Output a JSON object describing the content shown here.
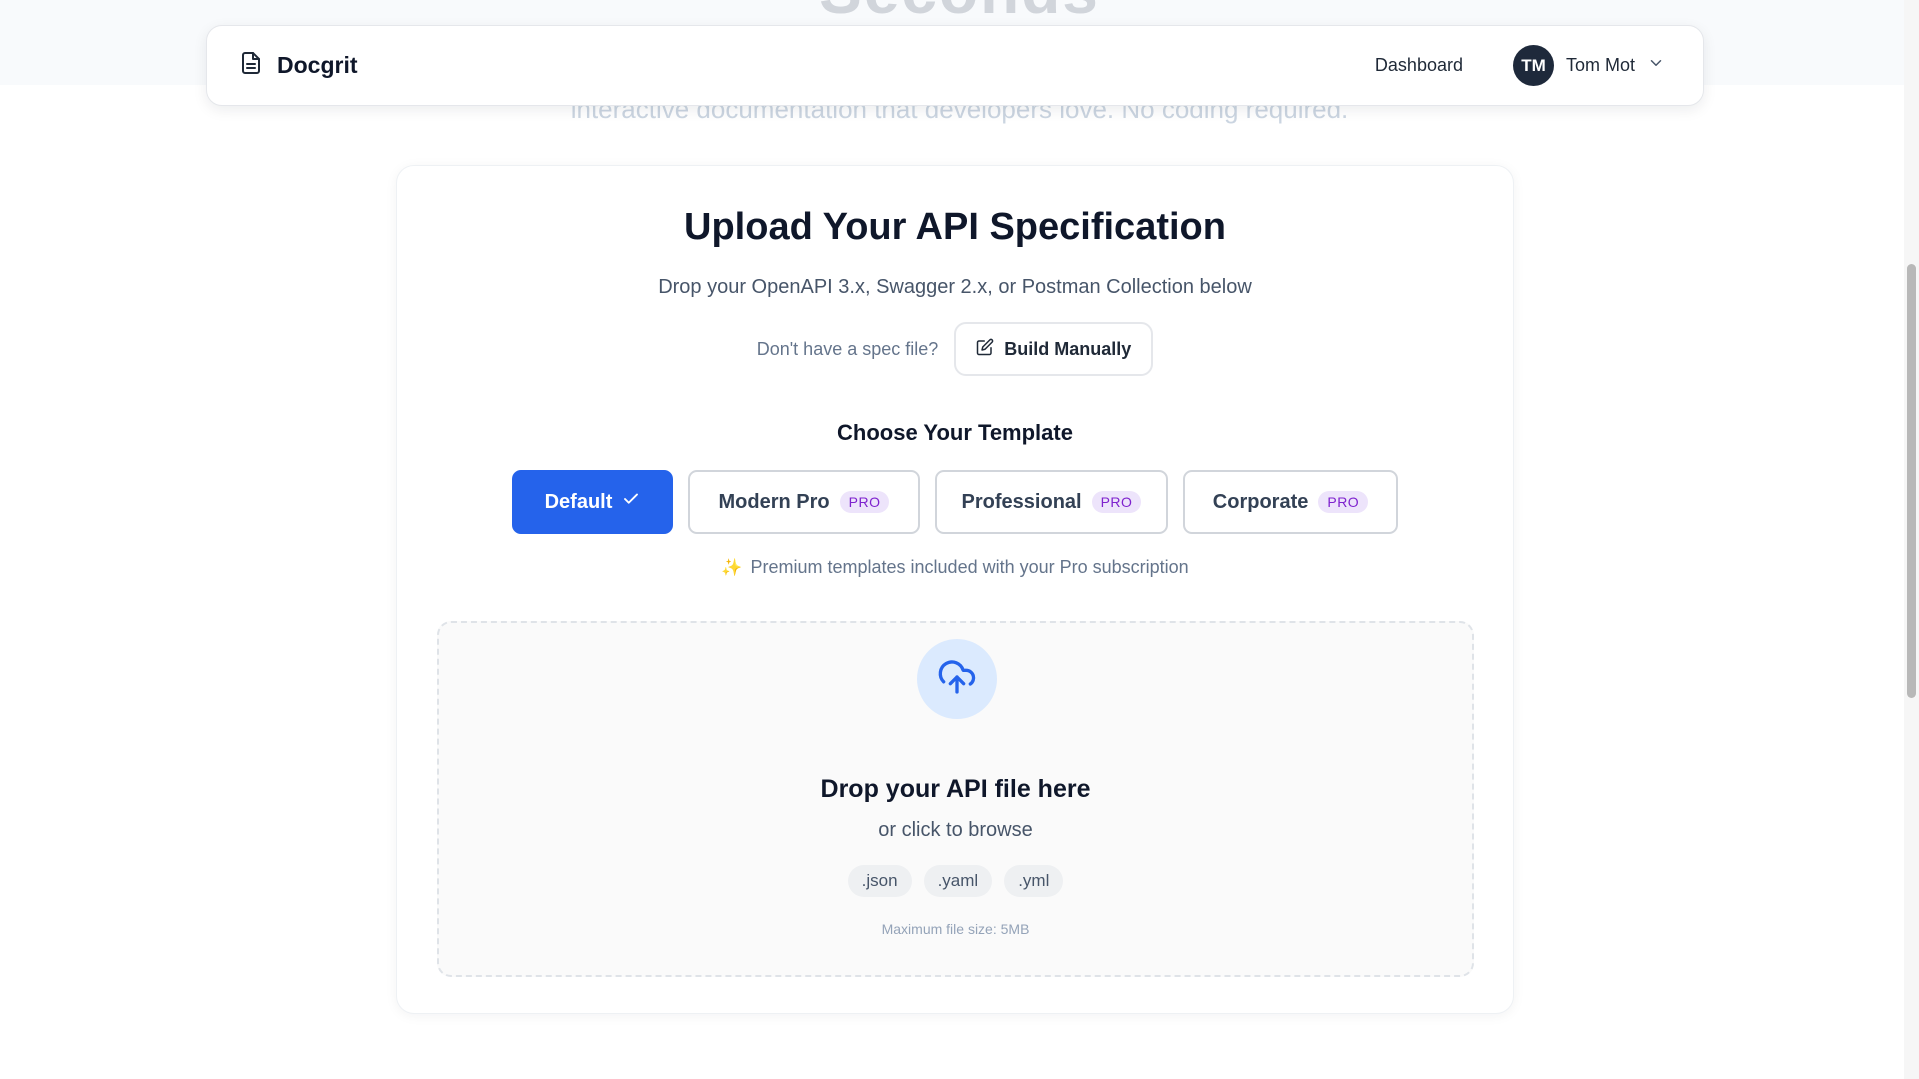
{
  "hero": {
    "ghost_title": "Seconds",
    "ghost_subtitle": "interactive documentation that developers love. No coding required."
  },
  "nav": {
    "brand": "Docgrit",
    "dashboard_label": "Dashboard",
    "user_initials": "TM",
    "user_name": "Tom Mot"
  },
  "upload_card": {
    "title": "Upload Your API Specification",
    "subtitle": "Drop your OpenAPI 3.x, Swagger 2.x, or Postman Collection below",
    "manual_hint": "Don't have a spec file?",
    "build_manually_label": "Build Manually",
    "template_heading": "Choose Your Template",
    "templates": [
      {
        "label": "Default",
        "selected": true,
        "pro": false
      },
      {
        "label": "Modern Pro",
        "selected": false,
        "pro": true,
        "badge": "PRO"
      },
      {
        "label": "Professional",
        "selected": false,
        "pro": true,
        "badge": "PRO"
      },
      {
        "label": "Corporate",
        "selected": false,
        "pro": true,
        "badge": "PRO"
      }
    ],
    "premium_note": "Premium templates included with your Pro subscription",
    "dropzone": {
      "title": "Drop your API file here",
      "subtitle": "or click to browse",
      "extensions": [
        ".json",
        ".yaml",
        ".yml"
      ],
      "max_size": "Maximum file size: 5MB"
    }
  },
  "colors": {
    "primary": "#2563eb",
    "pro_badge_bg": "#ede4fb",
    "pro_badge_text": "#7e22ce",
    "upload_circle_bg": "#dbeafe"
  }
}
